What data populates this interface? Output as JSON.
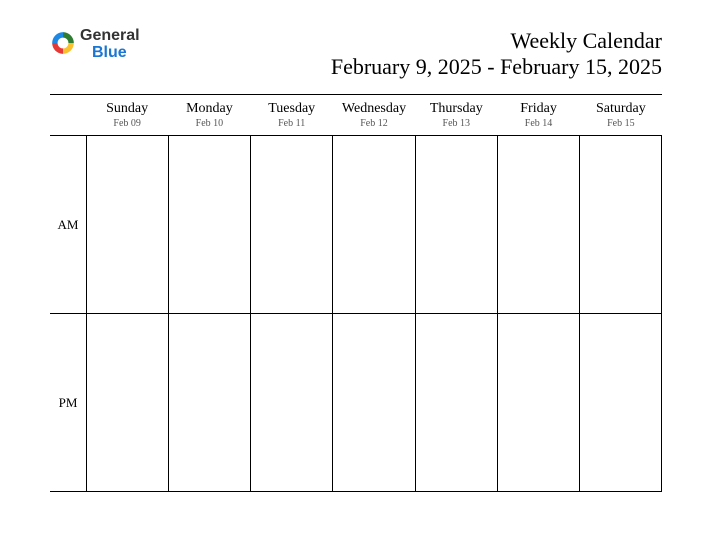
{
  "logo": {
    "word1": "General",
    "word2": "Blue",
    "pinwheel_colors": [
      "#2e7d32",
      "#fbc02d",
      "#e53935",
      "#1e88e5"
    ]
  },
  "title": {
    "line1": "Weekly Calendar",
    "line2": "February 9, 2025 - February 15, 2025"
  },
  "days": [
    {
      "name": "Sunday",
      "date": "Feb 09"
    },
    {
      "name": "Monday",
      "date": "Feb 10"
    },
    {
      "name": "Tuesday",
      "date": "Feb 11"
    },
    {
      "name": "Wednesday",
      "date": "Feb 12"
    },
    {
      "name": "Thursday",
      "date": "Feb 13"
    },
    {
      "name": "Friday",
      "date": "Feb 14"
    },
    {
      "name": "Saturday",
      "date": "Feb 15"
    }
  ],
  "periods": [
    "AM",
    "PM"
  ]
}
